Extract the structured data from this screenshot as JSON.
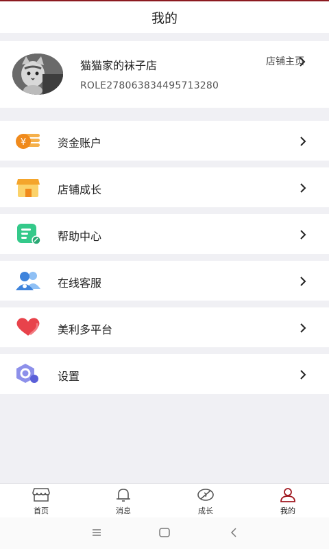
{
  "header": {
    "title": "我的"
  },
  "profile": {
    "shop_name": "猫猫家的袜子店",
    "shop_id": "ROLE278063834495713280",
    "shop_home_label": "店铺主页"
  },
  "menu": [
    {
      "label": "资金账户",
      "icon": "coin-account-icon",
      "color": "#f29a2e"
    },
    {
      "label": "店铺成长",
      "icon": "storefront-icon",
      "color": "#f6b93b"
    },
    {
      "label": "帮助中心",
      "icon": "help-document-icon",
      "color": "#3ccb8a"
    },
    {
      "label": "在线客服",
      "icon": "customer-service-icon",
      "color": "#4a8fe0"
    },
    {
      "label": "美利多平台",
      "icon": "heart-platform-icon",
      "color": "#e8434b"
    },
    {
      "label": "设置",
      "icon": "settings-hexagon-icon",
      "color": "#7b7fe6"
    }
  ],
  "tabbar": {
    "items": [
      {
        "label": "首页",
        "icon": "shop-home-icon"
      },
      {
        "label": "消息",
        "icon": "bell-icon"
      },
      {
        "label": "成长",
        "icon": "leaf-icon"
      },
      {
        "label": "我的",
        "icon": "person-icon",
        "active": true
      }
    ],
    "active_color": "#a01820"
  },
  "system_nav": {
    "buttons": [
      "recent-apps-icon",
      "home-icon",
      "back-icon"
    ]
  }
}
